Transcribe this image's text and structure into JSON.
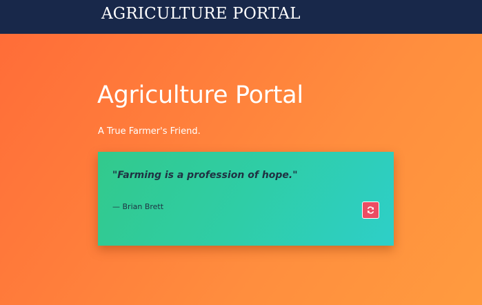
{
  "navbar": {
    "brand": "AGRICULTURE PORTAL"
  },
  "hero": {
    "title": "Agriculture Portal",
    "subtitle": "A True Farmer's Friend."
  },
  "quote": {
    "text": "\"Farming is a profession of hope.\"",
    "author": "— Brian Brett",
    "refresh_icon": "refresh-icon"
  },
  "colors": {
    "navbar": "#18284a",
    "background_start": "#ff6b38",
    "background_end": "#ff9b3f",
    "card_start": "#32c98c",
    "card_end": "#2ecfc8",
    "refresh_button": "#ec4c63",
    "quote_text": "#1f3142"
  }
}
